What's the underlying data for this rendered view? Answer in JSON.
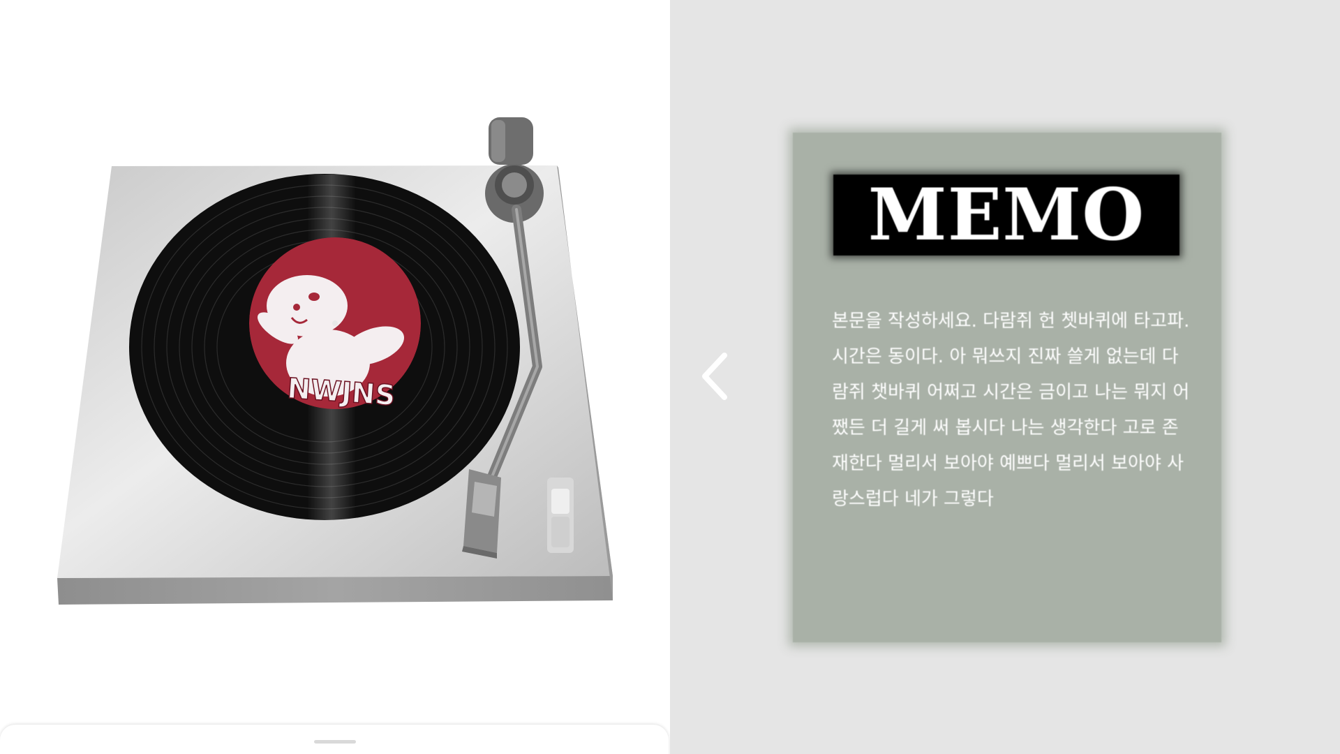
{
  "turntable": {
    "label_text": "NWJNS",
    "label_color": "#a62839",
    "record_color": "#111111",
    "deck_color": "#c4c4c4"
  },
  "navigation": {
    "prev_icon": "chevron-left-icon"
  },
  "memo": {
    "title": "MEMO",
    "card_color": "#a9b1a7",
    "body": "본문을 작성하세요. 다람쥐 헌 쳇바퀴에 타고파. 시간은 동이다. 아 뭐쓰지 진짜 쓸게 없는데 다람쥐 챗바퀴 어쩌고 시간은 금이고 나는 뭐지 어쨌든 더 길게 써 봅시다 나는 생각한다 고로 존재한다 멀리서 보아야 예쁘다 멀리서 보아야 사랑스럽다 네가 그렇다"
  }
}
